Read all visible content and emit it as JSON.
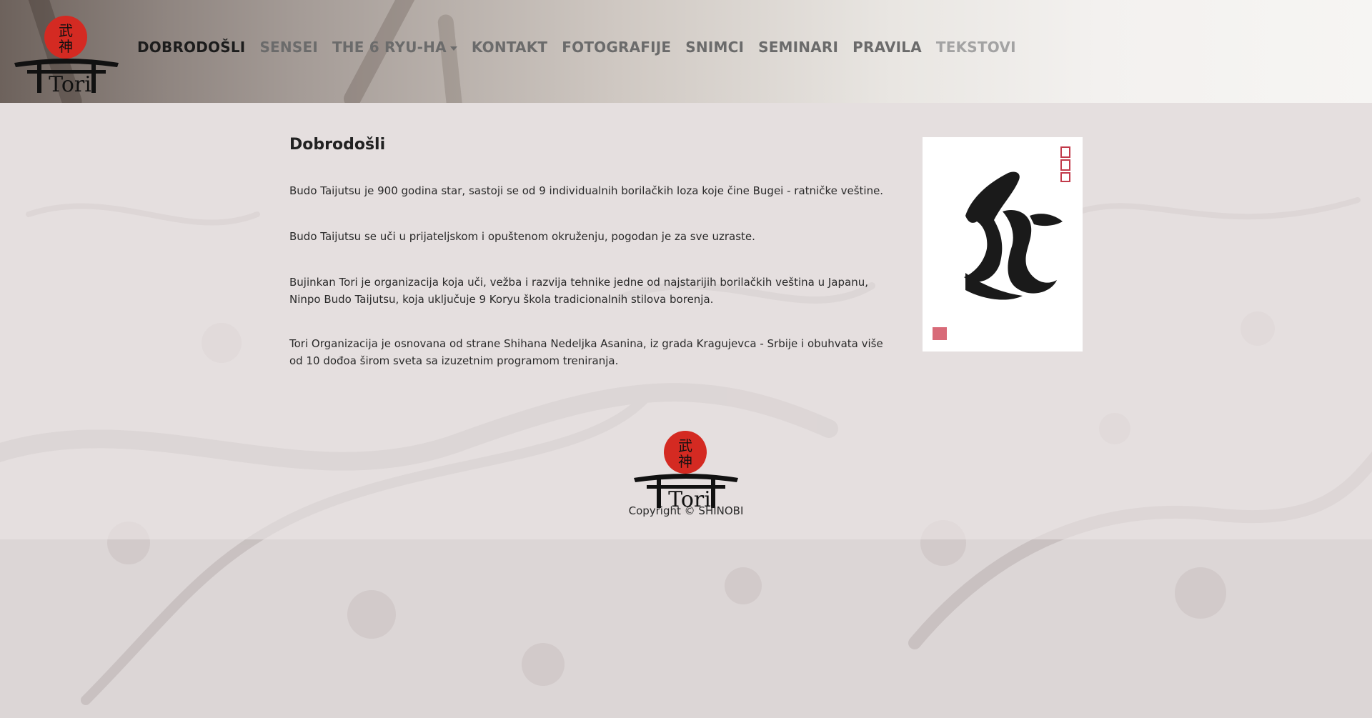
{
  "nav": {
    "logo_text": "Tori",
    "items": [
      {
        "label": "DOBRODOŠLI",
        "state": "active"
      },
      {
        "label": "SENSEI",
        "state": "normal"
      },
      {
        "label": "THE 6 RYU-HA",
        "state": "dropdown"
      },
      {
        "label": "KONTAKT",
        "state": "normal"
      },
      {
        "label": "FOTOGRAFIJE",
        "state": "normal"
      },
      {
        "label": "SNIMCI",
        "state": "normal"
      },
      {
        "label": "SEMINARI",
        "state": "normal"
      },
      {
        "label": "PRAVILA",
        "state": "normal"
      },
      {
        "label": "TEKSTOVI",
        "state": "muted"
      }
    ]
  },
  "main": {
    "title": "Dobrodošli",
    "paragraphs": [
      "Budo Taijutsu je 900 godina star, sastoji se od 9 individualnih borilačkih loza koje čine Bugei - ratničke veštine.",
      "Budo Taijutsu se uči u prijateljskom i opuštenom okruženju, pogodan je za sve uzraste.",
      "Bujinkan Tori je organizacija koja uči, vežba i razvija tehnike jedne od najstarijih borilačkih veština u Japanu, Ninpo Budo Taijutsu, koja uključuje 9 Koryu škola tradicionalnih stilova borenja.",
      "Tori Organizacija je osnovana od strane Shihana Nedeljka Asanina, iz grada Kragujevca - Srbije i obuhvata više od 10 dođoa širom sveta sa izuzetnim programom treniranja."
    ]
  },
  "footer": {
    "logo_text": "Tori",
    "copyright": "Copyright © SHINOBI"
  },
  "colors": {
    "logo_red": "#d42a22",
    "nav_active": "#1c1c1c",
    "nav_normal": "#6b6b6b",
    "nav_muted": "#a3a3a3",
    "background": "#d9d3d3"
  }
}
